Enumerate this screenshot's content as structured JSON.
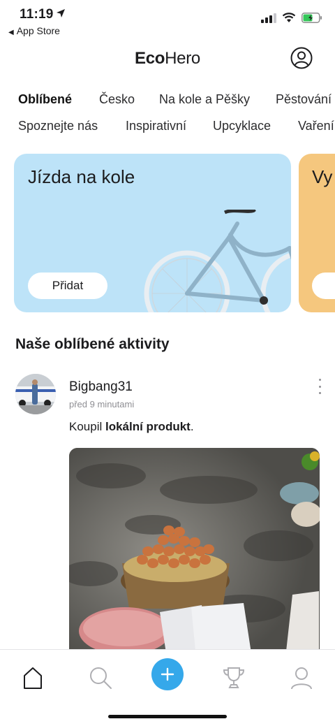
{
  "status_bar": {
    "time": "11:19",
    "back_label": "App Store",
    "battery_level": 0.6
  },
  "header": {
    "logo_bold": "Eco",
    "logo_light": "Hero"
  },
  "categories": {
    "row1": [
      "Oblíbené",
      "Česko",
      "Na kole a Pěšky",
      "Pěstování"
    ],
    "row2": [
      "Spoznejte nás",
      "Inspirativní",
      "Upcyklace",
      "Vaření"
    ],
    "active": "Oblíbené"
  },
  "cards": [
    {
      "title": "Jízda na kole",
      "button": "Přidat",
      "color": "#bde3f8"
    },
    {
      "title": "Vy",
      "color": "#f5c77e"
    }
  ],
  "section": {
    "title": "Naše oblíbené aktivity"
  },
  "post": {
    "username": "Bigbang31",
    "time_ago": "před 9 minutami",
    "text_prefix": "Koupil ",
    "text_bold": "lokální produkt",
    "text_suffix": "."
  },
  "tabbar": {
    "items": [
      "home-icon",
      "search-icon",
      "add-icon",
      "trophy-icon",
      "profile-icon"
    ],
    "accent": "#35a8ea"
  }
}
